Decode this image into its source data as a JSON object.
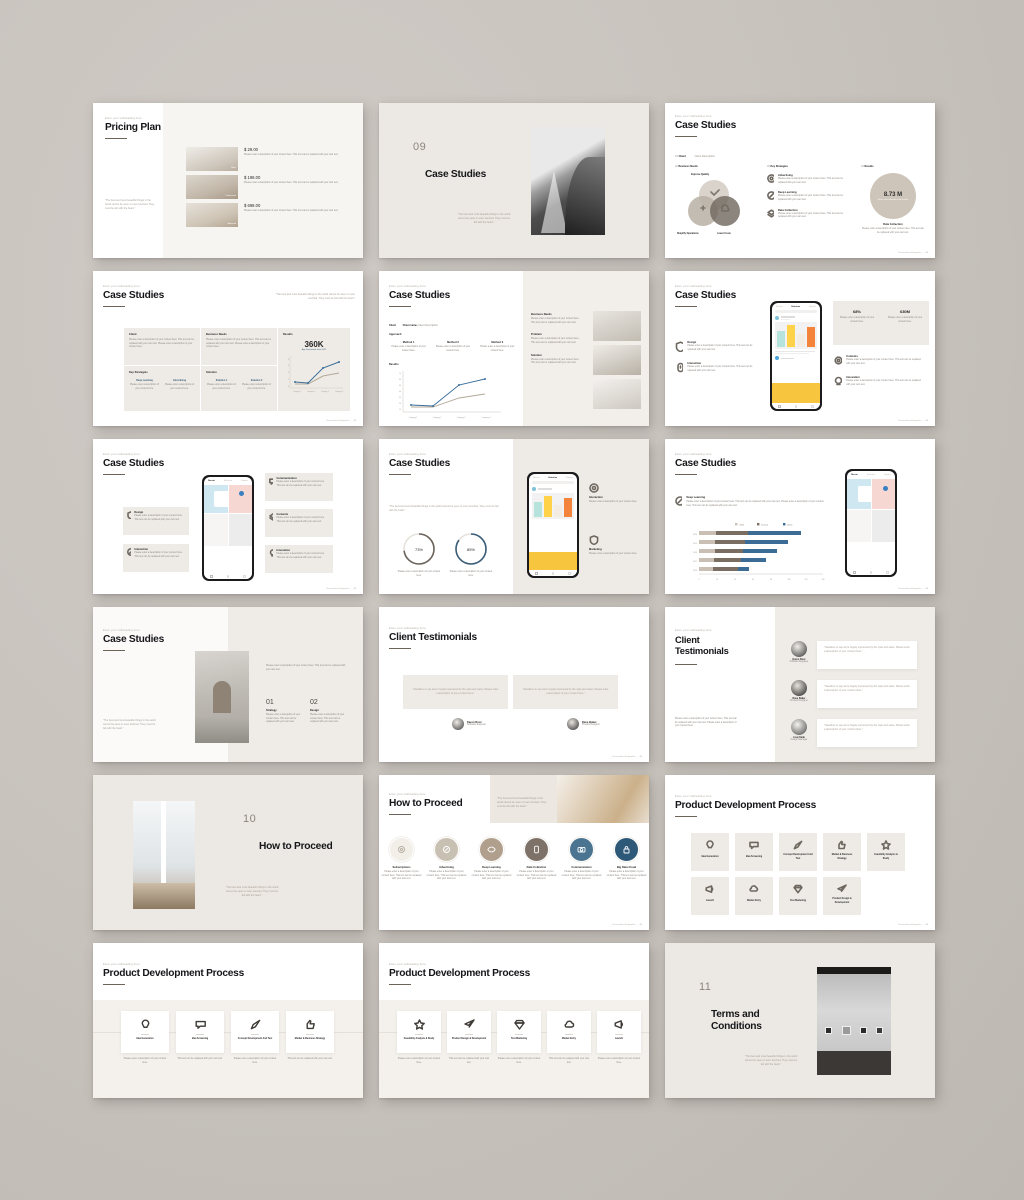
{
  "canvas": {
    "background": "#c7c2bc"
  },
  "common": {
    "eyebrow": "Enter your subheading here",
    "quote": "\"The best and most beautiful things in the world cannot be seen or even touched. They must be felt with the heart.\"",
    "body_a": "Please enter a description of your content here. This text can be replaced with your own text.",
    "body_b": "This text can be replaced with your own text.",
    "footer_label": "Presentation Infographics",
    "footer_page": "01"
  },
  "slides": [
    {
      "id": "pricing-plan",
      "title": "Pricing Plan",
      "eyebrow": "Enter your subheading here",
      "quote": "\"The best and most beautiful things in the world cannot be seen or even touched. They must be felt with the heart.\"",
      "items": [
        {
          "price": "$ 29.00",
          "tag": "Basic",
          "desc": "Please enter a description of your content here. This text can be replaced with your own text."
        },
        {
          "price": "$ 198.00",
          "tag": "Professional",
          "desc": "Please enter a description of your content here. This text can be replaced with your own text."
        },
        {
          "price": "$ 698.00",
          "tag": "Advanced",
          "desc": "Please enter a description of your content here. This text can be replaced with your own text."
        }
      ]
    },
    {
      "id": "case-studies-divider",
      "number": "09",
      "title": "Case Studies",
      "quote": "\"The best and most beautiful things in the world cannot be seen or even touched. They must be felt with the heart.\""
    },
    {
      "id": "case-studies-venn",
      "title": "Case Studies",
      "sections": [
        {
          "num": "01",
          "label": "Client",
          "value": "Client name,",
          "sub": "Client Description"
        },
        {
          "num": "02",
          "label": "Business Needs"
        },
        {
          "num": "03",
          "label": "Key Strategies"
        },
        {
          "num": "04",
          "label": "Results"
        }
      ],
      "venn": {
        "top": "Improve Quality",
        "left": "Simplify Operations",
        "right": "Lower Costs"
      },
      "strategies": [
        {
          "name": "Advertising",
          "icon": "target-icon"
        },
        {
          "name": "Deep Learning",
          "icon": "compass-icon"
        },
        {
          "name": "Data Collection",
          "icon": "layers-icon"
        }
      ],
      "result": {
        "value": "8.73 M",
        "caption": "Please enter subscriber in the text box",
        "title": "Data Collection",
        "desc": "Please enter a description of your content here. This text can be replaced with your own text."
      }
    },
    {
      "id": "case-studies-360k",
      "title": "Case Studies",
      "cards": [
        {
          "head": "Client",
          "desc": "Please enter a description of your content here. This text can be replaced with your own text. Please enter a description of your content here."
        },
        {
          "head": "Business Needs",
          "desc": "Please enter a description of your content here. This text can be replaced with your own text. Please enter a description of your content here."
        },
        {
          "head": "Key Strategies",
          "cols": [
            {
              "t": "Deep Learning",
              "d": "Please enter a description of your content here."
            },
            {
              "t": "Advertising",
              "d": "Please enter a description of your content here."
            }
          ]
        },
        {
          "head": "Solution",
          "cols": [
            {
              "t": "Solution 1",
              "d": "Please enter a description of your content here."
            },
            {
              "t": "Solution 2",
              "d": "Please enter a description of your content here."
            }
          ]
        }
      ],
      "result": {
        "head": "Results",
        "value": "360K",
        "caption": "App Downloads from 2021"
      },
      "chart": {
        "categories": [
          "Category 1",
          "Category 2",
          "Category 3",
          "Category 4"
        ]
      }
    },
    {
      "id": "case-studies-approach",
      "title": "Case Studies",
      "client_label": "Client",
      "client_value": "Client name,",
      "client_sub": "Client Description",
      "approach_label": "Approach",
      "approach": [
        {
          "t": "Method 1",
          "d": "Please enter a description of your content here."
        },
        {
          "t": "Method 2",
          "d": "Please enter a description of your content here."
        },
        {
          "t": "Method 3",
          "d": "Please enter a description of your content here."
        }
      ],
      "results_label": "Results",
      "right": [
        {
          "t": "Business Needs",
          "d": "Please enter a description of your content here. This text can be replaced with your own text."
        },
        {
          "t": "Problem",
          "d": "Please enter a description of your content here. This text can be replaced with your own text."
        },
        {
          "t": "Solution",
          "d": "Please enter a description of your content here. This text can be replaced with your own text."
        }
      ]
    },
    {
      "id": "case-studies-phone-stats",
      "title": "Case Studies",
      "left": [
        {
          "t": "Design",
          "d": "Please enter a description of your content here. This text can be replaced with your own text.",
          "icon": "shield-icon"
        },
        {
          "t": "Interaction",
          "d": "Please enter a description of your content here. This text can be replaced with your own text.",
          "icon": "touch-icon"
        }
      ],
      "stats": [
        {
          "v": "68%",
          "d": "Please enter a description of your content here."
        },
        {
          "v": "630M",
          "d": "Please enter a description of your content here."
        }
      ],
      "right": [
        {
          "t": "Contents",
          "d": "Please enter a description of your content here. This text can be replaced with your own text.",
          "icon": "gear-icon"
        },
        {
          "t": "Innovation",
          "d": "Please enter a description of your content here. This text can be replaced with your own text.",
          "icon": "bulb-icon"
        }
      ]
    },
    {
      "id": "case-studies-6cards",
      "title": "Case Studies",
      "left": [
        {
          "t": "Design",
          "d": "Please enter a description of your content here. This text can be replaced with your own text.",
          "icon": "shield-icon"
        },
        {
          "t": "Interaction",
          "d": "Please enter a description of your content here. This text can be replaced with your own text.",
          "icon": "compass-icon"
        }
      ],
      "right": [
        {
          "t": "Communication",
          "d": "Please enter a description of your content here. This text can be replaced with your own text.",
          "icon": "chat-icon"
        },
        {
          "t": "Contents",
          "d": "Please enter a description of your content here. This text can be replaced with your own text.",
          "icon": "layers-icon"
        },
        {
          "t": "Innovation",
          "d": "Please enter a description of your content here. This text can be replaced with your own text.",
          "icon": "bulb-icon"
        }
      ]
    },
    {
      "id": "case-studies-donuts",
      "title": "Case Studies",
      "quote": "\"The best and most beautiful things in the world cannot be seen or even touched. They must be felt with the heart.\"",
      "donuts": [
        {
          "value": 73,
          "label": "73%",
          "desc": "Please enter a description of your content here.",
          "color": "#6b645c"
        },
        {
          "value": 85,
          "label": "85%",
          "desc": "Please enter a description of your content here.",
          "color": "#3a5d78"
        }
      ],
      "right": [
        {
          "t": "Interaction",
          "d": "Please enter a description of your content here.",
          "icon": "target-icon"
        },
        {
          "t": "Marketing",
          "d": "Please enter a description of your content here.",
          "icon": "shield-icon"
        }
      ]
    },
    {
      "id": "case-studies-bars",
      "title": "Case Studies",
      "topic": {
        "t": "Deep Learning",
        "d": "Please enter a description of your content here. This text can be replaced with your own text. Please enter a description of your content here. This text can be replaced with your own text.",
        "icon": "compass-icon"
      },
      "chart_data": {
        "type": "bar",
        "orientation": "horizontal",
        "stacked": true,
        "title": "",
        "categories": [
          "2016",
          "2017",
          "2018",
          "2019",
          "2020"
        ],
        "series": [
          {
            "name": "Tablet",
            "color": "#c9bfb4",
            "values": [
              20,
              22,
              24,
              25,
              26
            ]
          },
          {
            "name": "Desktop",
            "color": "#7a6e63",
            "values": [
              28,
              30,
              32,
              34,
              36
            ]
          },
          {
            "name": "Mobile",
            "color": "#3b6c96",
            "values": [
              12,
              28,
              38,
              48,
              60
            ]
          }
        ],
        "xlabel": "",
        "ylabel": "",
        "xticks": [
          "0",
          "20",
          "40",
          "60",
          "80",
          "100",
          "120",
          "140"
        ],
        "xlim": [
          0,
          140
        ],
        "legend": "top",
        "grid": false
      }
    },
    {
      "id": "case-studies-0102",
      "title": "Case Studies",
      "quote": "\"The best and most beautiful things in the world cannot be seen or even touched. They must be felt with the heart.\"",
      "desc": "Please enter a description of your content here. This text can be replaced with your own text.",
      "items": [
        {
          "num": "01",
          "t": "Strategy",
          "d": "Please enter a description of your content here. This text can be replaced with your own text."
        },
        {
          "num": "02",
          "t": "Design",
          "d": "Please enter a description of your content here. This text can be replaced with your own text."
        }
      ]
    },
    {
      "id": "client-testimonials-two",
      "title": "Client Testimonials",
      "cards": [
        {
          "quote": "\"Needless to say we're hugely impressed by the style and value. Please enter a description of your content here.\"",
          "name": "Karen Root",
          "role": "Software Engineer"
        },
        {
          "quote": "\"Needless to say we're hugely impressed by the style and value. Please enter a description of your content here.\"",
          "name": "Dave Baker",
          "role": "Product Designer"
        }
      ]
    },
    {
      "id": "client-testimonials-three",
      "title_l1": "Client",
      "title_l2": "Testimonials",
      "desc": "Please enter a description of your content here. This text can be replaced with your own text. Please enter a description of your content here.",
      "cards": [
        {
          "name": "Karen Root",
          "role": "Software Engineer",
          "quote": "\"Needless to say we're hugely impressed by the style and value. Please enter a description of your content here.\""
        },
        {
          "name": "Dave Baker",
          "role": "Product Designer",
          "quote": "\"Needless to say we're hugely impressed by the style and value. Please enter a description of your content here.\""
        },
        {
          "name": "Lisa Flank",
          "role": "Design Manager",
          "quote": "\"Needless to say we're hugely impressed by the style and value. Please enter a description of your content here.\""
        }
      ]
    },
    {
      "id": "how-to-proceed-divider",
      "number": "10",
      "title": "How to Proceed",
      "quote": "\"The best and most beautiful things in the world cannot be seen or even touched. They must be felt with the heart.\""
    },
    {
      "id": "how-to-proceed-steps",
      "title": "How to Proceed",
      "quote": "\"The best and most beautiful things in the world cannot be seen or even touched. They must be felt with the heart.\"",
      "steps": [
        {
          "t": "Subscriptions",
          "d": "Please enter a description of your content here. This text can be replaced with your own text.",
          "color": "#f2efe9",
          "icon": "gear-icon"
        },
        {
          "t": "Advertising",
          "d": "Please enter a description of your content here. This text can be replaced with your own text.",
          "color": "#c9c0b4",
          "icon": "compass-icon"
        },
        {
          "t": "Deep Learning",
          "d": "Please enter a description of your content here. This text can be replaced with your own text.",
          "color": "#b09f8d",
          "icon": "eye-icon"
        },
        {
          "t": "Data Collection",
          "d": "Please enter a description of your content here. This text can be replaced with your own text.",
          "color": "#7d7168",
          "icon": "phone-icon"
        },
        {
          "t": "Communication",
          "d": "Please enter a description of your content here. This text can be replaced with your own text.",
          "color": "#4a7490",
          "icon": "camera-icon"
        },
        {
          "t": "Big Data Cloud",
          "d": "Please enter a description of your content here. This text can be replaced with your own text.",
          "color": "#2e5878",
          "icon": "lock-icon"
        }
      ]
    },
    {
      "id": "pdp-grid-nine",
      "title": "Product Development Process",
      "row1": [
        {
          "t": "Idea Generation",
          "icon": "bulb-icon"
        },
        {
          "t": "Idea Screening",
          "icon": "chat-icon"
        },
        {
          "t": "Concept Development And Test",
          "icon": "rocket-icon"
        },
        {
          "t": "Market & Business Strategy",
          "icon": "thumb-icon"
        },
        {
          "t": "Feasibility Analysis & Study",
          "icon": "star-icon"
        }
      ],
      "row2": [
        {
          "t": "Launch",
          "icon": "megaphone-icon"
        },
        {
          "t": "Market Entry",
          "icon": "cloud-icon"
        },
        {
          "t": "Test Marketing",
          "icon": "diamond-icon"
        },
        {
          "t": "Product Design & Development",
          "icon": "paperplane-icon"
        }
      ]
    },
    {
      "id": "pdp-cards-four",
      "title": "Product Development Process",
      "cards": [
        {
          "t": "Idea Generation",
          "d": "Please enter a description of your content here.",
          "icon": "bulb-icon"
        },
        {
          "t": "Idea Screening",
          "d": "This text can be replaced with your own text.",
          "icon": "chat-icon"
        },
        {
          "t": "Concept Development And Test",
          "d": "Please enter a description of your content here.",
          "icon": "rocket-icon"
        },
        {
          "t": "Market & Business Strategy",
          "d": "This text can be replaced with your own text.",
          "icon": "thumb-icon"
        }
      ]
    },
    {
      "id": "pdp-cards-five",
      "title": "Product Development Process",
      "cards": [
        {
          "t": "Feasibility Analysis & Study",
          "d": "Please enter a description of your content here.",
          "icon": "star-icon"
        },
        {
          "t": "Product Design & Development",
          "d": "This text can be replaced with your own text.",
          "icon": "paperplane-icon"
        },
        {
          "t": "Test Marketing",
          "d": "Please enter a description of your content here.",
          "icon": "diamond-icon"
        },
        {
          "t": "Market Entry",
          "d": "This text can be replaced with your own text.",
          "icon": "cloud-icon"
        },
        {
          "t": "Launch",
          "d": "Please enter a description of your content here.",
          "icon": "megaphone-icon"
        }
      ]
    },
    {
      "id": "terms-divider",
      "number": "11",
      "title_l1": "Terms and",
      "title_l2": "Conditions",
      "quote": "\"The best and most beautiful things in the world cannot be seen or even touched. They must be felt with the heart.\""
    }
  ]
}
